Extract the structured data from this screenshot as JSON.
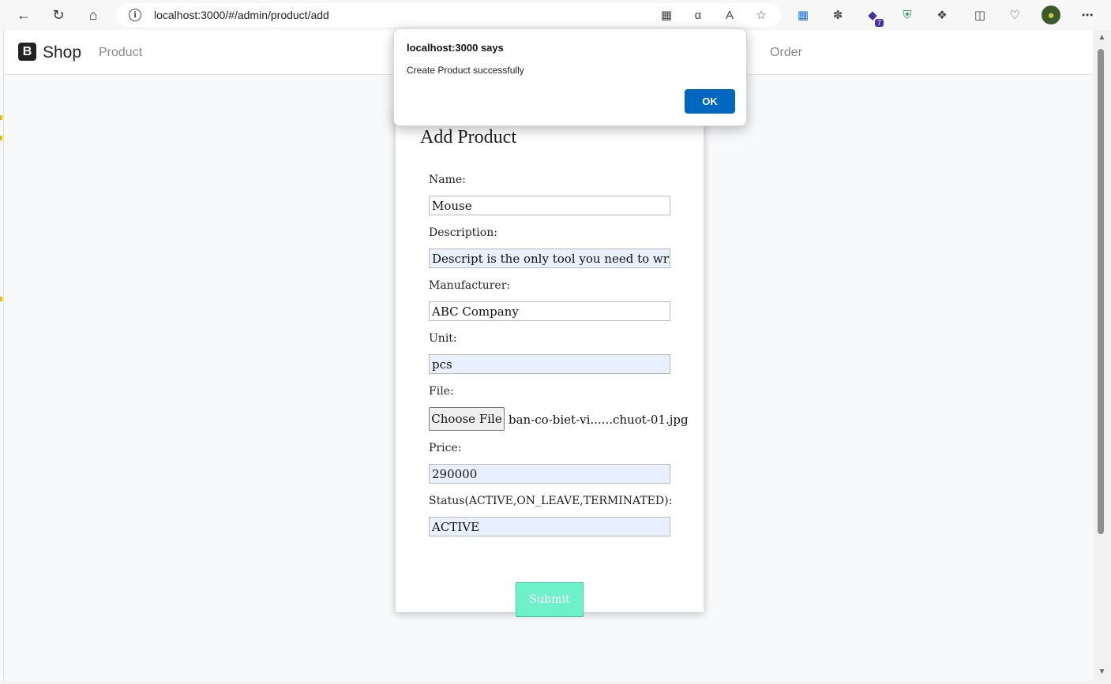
{
  "browser": {
    "url": "localhost:3000/#/admin/product/add",
    "extension_badge": "7"
  },
  "navbar": {
    "brand_letter": "B",
    "brand_name": "Shop",
    "links": [
      "Product",
      "Order"
    ]
  },
  "form": {
    "title": "Add Product",
    "fields": {
      "name": {
        "label": "Name:",
        "value": "Mouse"
      },
      "description": {
        "label": "Description:",
        "value": "Descript is the only tool you need to write, record"
      },
      "manufacturer": {
        "label": "Manufacturer:",
        "value": "ABC Company"
      },
      "unit": {
        "label": "Unit:",
        "value": "pcs"
      },
      "file": {
        "label": "File:",
        "button": "Choose File",
        "filename": "ban-co-biet-vi......chuot-01.jpg"
      },
      "price": {
        "label": "Price:",
        "value": "290000"
      },
      "status": {
        "label": "Status(ACTIVE,ON_LEAVE,TERMINATED):",
        "value": "ACTIVE"
      }
    },
    "submit_label": "Submit"
  },
  "dialog": {
    "title": "localhost:3000 says",
    "message": "Create Product successfully",
    "ok_label": "OK"
  },
  "colors": {
    "submit_bg": "#6ef0c8",
    "ok_bg": "#0067c0",
    "autofill_bg": "#e8f0fe"
  }
}
